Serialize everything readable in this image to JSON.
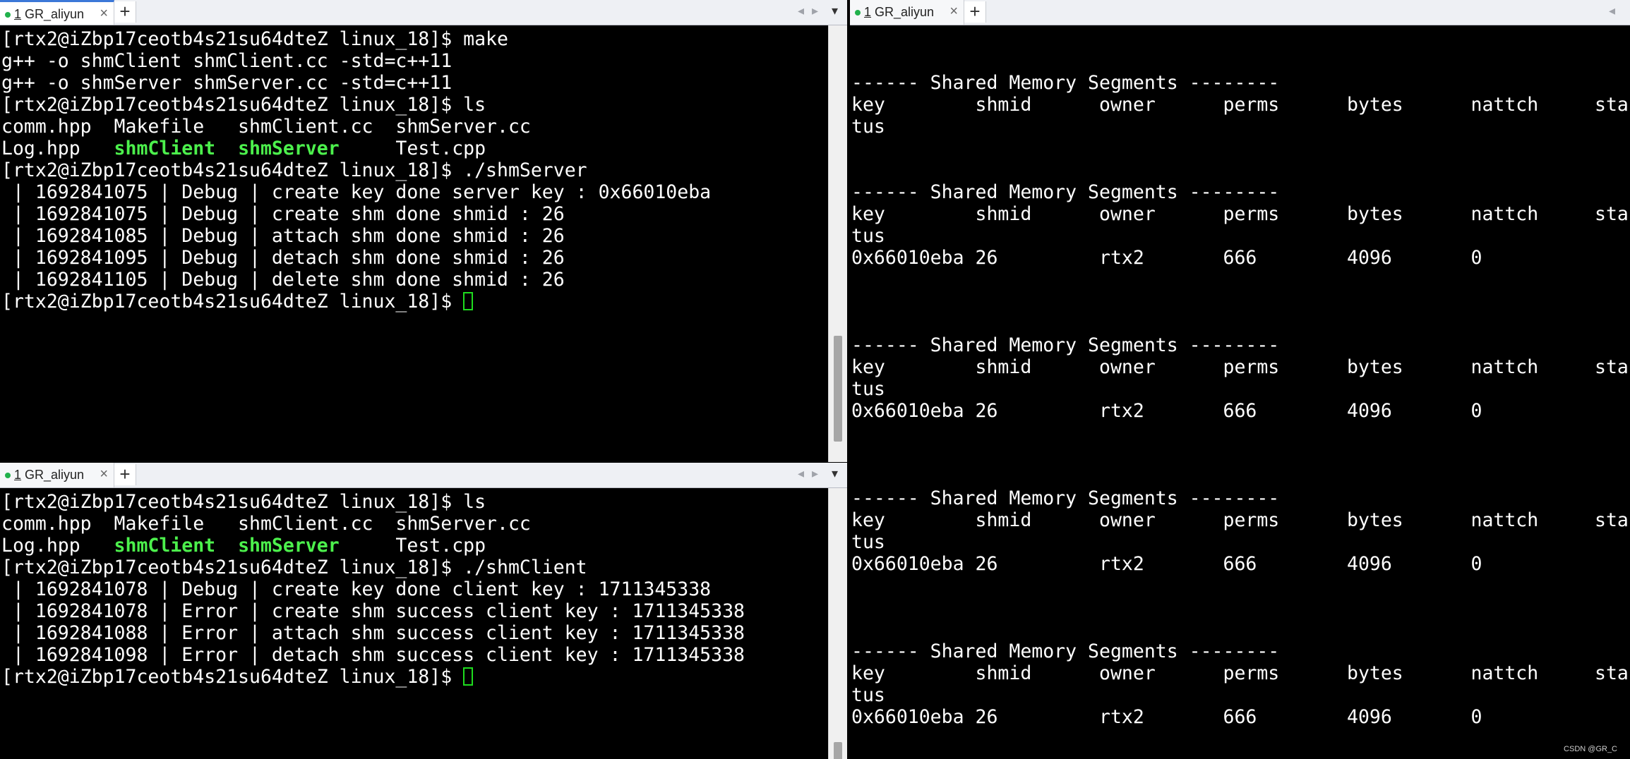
{
  "tab_title_num": "1",
  "tab_title_name": " GR_aliyun",
  "icons": {
    "close": "×",
    "add": "+",
    "nav_left": "◂",
    "nav_right": "▸",
    "menu": "▾"
  },
  "top_left": {
    "lines": [
      [
        {
          "t": "[rtx2@iZbp17ceotb4s21su64dteZ linux_18]$ make"
        }
      ],
      [
        {
          "t": "g++ -o shmClient shmClient.cc -std=c++11"
        }
      ],
      [
        {
          "t": "g++ -o shmServer shmServer.cc -std=c++11"
        }
      ],
      [
        {
          "t": "[rtx2@iZbp17ceotb4s21su64dteZ linux_18]$ ls"
        }
      ],
      [
        {
          "t": "comm.hpp  Makefile   shmClient.cc  shmServer.cc"
        }
      ],
      [
        {
          "t": "Log.hpp   "
        },
        {
          "t": "shmClient",
          "c": "exe"
        },
        {
          "t": "  "
        },
        {
          "t": "shmServer",
          "c": "exe"
        },
        {
          "t": "     Test.cpp"
        }
      ],
      [
        {
          "t": "[rtx2@iZbp17ceotb4s21su64dteZ linux_18]$ ./shmServer"
        }
      ],
      [
        {
          "t": " | 1692841075 | Debug | create key done server key : 0x66010eba"
        }
      ],
      [
        {
          "t": " | 1692841075 | Debug | create shm done shmid : 26"
        }
      ],
      [
        {
          "t": " | 1692841085 | Debug | attach shm done shmid : 26"
        }
      ],
      [
        {
          "t": " | 1692841095 | Debug | detach shm done shmid : 26"
        }
      ],
      [
        {
          "t": " | 1692841105 | Debug | delete shm done shmid : 26"
        }
      ],
      [
        {
          "t": "[rtx2@iZbp17ceotb4s21su64dteZ linux_18]$ "
        },
        {
          "cursor": true
        }
      ]
    ]
  },
  "bottom_left": {
    "lines": [
      [
        {
          "t": "[rtx2@iZbp17ceotb4s21su64dteZ linux_18]$ ls"
        }
      ],
      [
        {
          "t": "comm.hpp  Makefile   shmClient.cc  shmServer.cc"
        }
      ],
      [
        {
          "t": "Log.hpp   "
        },
        {
          "t": "shmClient",
          "c": "exe"
        },
        {
          "t": "  "
        },
        {
          "t": "shmServer",
          "c": "exe"
        },
        {
          "t": "     Test.cpp"
        }
      ],
      [
        {
          "t": "[rtx2@iZbp17ceotb4s21su64dteZ linux_18]$ ./shmClient"
        }
      ],
      [
        {
          "t": " | 1692841078 | Debug | create key done client key : 1711345338"
        }
      ],
      [
        {
          "t": " | 1692841078 | Error | create shm success client key : 1711345338"
        }
      ],
      [
        {
          "t": " | 1692841088 | Error | attach shm success client key : 1711345338"
        }
      ],
      [
        {
          "t": " | 1692841098 | Error | detach shm success client key : 1711345338"
        }
      ],
      [
        {
          "t": "[rtx2@iZbp17ceotb4s21su64dteZ linux_18]$ "
        },
        {
          "cursor": true
        }
      ]
    ]
  },
  "right": {
    "lines": [
      [],
      [],
      [
        {
          "t": "------ Shared Memory Segments --------"
        }
      ],
      [
        {
          "t": "key        shmid      owner      perms      bytes      nattch     sta"
        }
      ],
      [
        {
          "t": "tus"
        }
      ],
      [],
      [],
      [
        {
          "t": "------ Shared Memory Segments --------"
        }
      ],
      [
        {
          "t": "key        shmid      owner      perms      bytes      nattch     sta"
        }
      ],
      [
        {
          "t": "tus"
        }
      ],
      [
        {
          "t": "0x66010eba 26         rtx2       666        4096       0"
        }
      ],
      [],
      [],
      [],
      [
        {
          "t": "------ Shared Memory Segments --------"
        }
      ],
      [
        {
          "t": "key        shmid      owner      perms      bytes      nattch     sta"
        }
      ],
      [
        {
          "t": "tus"
        }
      ],
      [
        {
          "t": "0x66010eba 26         rtx2       666        4096       0"
        }
      ],
      [],
      [],
      [],
      [
        {
          "t": "------ Shared Memory Segments --------"
        }
      ],
      [
        {
          "t": "key        shmid      owner      perms      bytes      nattch     sta"
        }
      ],
      [
        {
          "t": "tus"
        }
      ],
      [
        {
          "t": "0x66010eba 26         rtx2       666        4096       0"
        }
      ],
      [],
      [],
      [],
      [
        {
          "t": "------ Shared Memory Segments --------"
        }
      ],
      [
        {
          "t": "key        shmid      owner      perms      bytes      nattch     sta"
        }
      ],
      [
        {
          "t": "tus"
        }
      ],
      [
        {
          "t": "0x66010eba 26         rtx2       666        4096       0"
        }
      ]
    ]
  },
  "watermark": "CSDN @GR_C"
}
